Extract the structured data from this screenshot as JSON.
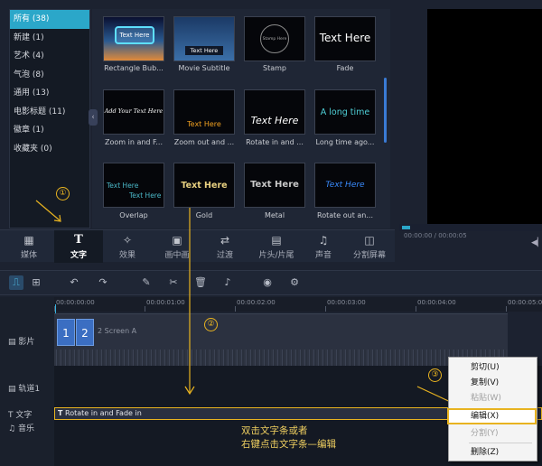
{
  "categories": [
    {
      "label": "所有 (38)",
      "selected": true
    },
    {
      "label": "新建 (1)"
    },
    {
      "label": "艺术 (4)"
    },
    {
      "label": "气泡 (8)"
    },
    {
      "label": "通用 (13)"
    },
    {
      "label": "电影标题 (11)"
    },
    {
      "label": "徽章 (1)"
    },
    {
      "label": "收藏夹 (0)"
    }
  ],
  "templates": [
    {
      "label": "Rectangle Bub...",
      "preview": "Text Here"
    },
    {
      "label": "Movie Subtitle",
      "preview": "Text Here"
    },
    {
      "label": "Stamp",
      "preview": "Stamp Here"
    },
    {
      "label": "Fade",
      "preview": "Text Here"
    },
    {
      "label": "Zoom in and F...",
      "preview": "Add Your Text Here"
    },
    {
      "label": "Zoom out and ...",
      "preview": "Text Here"
    },
    {
      "label": "Rotate in and ...",
      "preview": "Text Here"
    },
    {
      "label": "Long time ago...",
      "preview": "A long time"
    },
    {
      "label": "Overlap",
      "preview": "Text Here",
      "preview2": "Text Here"
    },
    {
      "label": "Gold",
      "preview": "Text Here"
    },
    {
      "label": "Metal",
      "preview": "Text Here"
    },
    {
      "label": "Rotate out an...",
      "preview": "Text Here"
    }
  ],
  "tabs": [
    {
      "label": "媒体",
      "icon": "media-icon"
    },
    {
      "label": "文字",
      "icon": "text-icon",
      "selected": true
    },
    {
      "label": "效果",
      "icon": "effects-icon"
    },
    {
      "label": "画中画",
      "icon": "pip-icon"
    },
    {
      "label": "过渡",
      "icon": "transition-icon"
    },
    {
      "label": "片头/片尾",
      "icon": "intro-outro-icon"
    },
    {
      "label": "声音",
      "icon": "sound-icon"
    },
    {
      "label": "分割屏幕",
      "icon": "split-screen-icon"
    }
  ],
  "preview": {
    "timecode": "00:00:00 / 00:00:05",
    "progress": 0.0
  },
  "ruler": [
    "00:00:00:00",
    "00:00:01:00",
    "00:00:02:00",
    "00:00:03:00",
    "00:00:04:00",
    "00:00:05:00"
  ],
  "tracks": {
    "video": "影片",
    "track1": "轨道1",
    "text": "文字",
    "music": "音乐"
  },
  "video_clip": {
    "thumb1": "1",
    "thumb2": "2",
    "name": "2 Screen A"
  },
  "text_clip": {
    "label": "Rotate in and Fade in",
    "icon": "T"
  },
  "annotations": {
    "n1": "①",
    "n2": "②",
    "n3": "③",
    "note_line1": "双击文字条或者",
    "note_line2": "右键点击文字条—编辑"
  },
  "context_menu": [
    {
      "label": "剪切(U)",
      "enabled": true
    },
    {
      "label": "复制(V)",
      "enabled": true
    },
    {
      "label": "粘贴(W)",
      "enabled": false
    },
    {
      "label": "编辑(X)",
      "enabled": true,
      "highlighted": true
    },
    {
      "label": "分割(Y)",
      "enabled": false
    },
    {
      "label": "删除(Z)",
      "enabled": true
    }
  ],
  "colors": {
    "accent": "#2ba7c9",
    "annotation": "#e8b320",
    "clip": "#3b6ec2"
  }
}
